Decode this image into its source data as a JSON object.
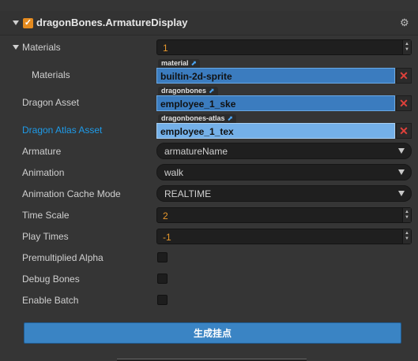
{
  "component": {
    "title": "dragonBones.ArmatureDisplay",
    "enabled": true,
    "gear_icon": "gear-icon"
  },
  "materials": {
    "label": "Materials",
    "count": "1",
    "item_label": "Materials",
    "item_tag": "material",
    "item_value": "builtin-2d-sprite"
  },
  "dragon_asset": {
    "label": "Dragon Asset",
    "tag": "dragonbones",
    "value": "employee_1_ske"
  },
  "dragon_atlas_asset": {
    "label": "Dragon Atlas Asset",
    "tag": "dragonbones-atlas",
    "value": "employee_1_tex"
  },
  "armature": {
    "label": "Armature",
    "value": "armatureName"
  },
  "animation": {
    "label": "Animation",
    "value": "walk"
  },
  "animation_cache_mode": {
    "label": "Animation Cache Mode",
    "value": "REALTIME"
  },
  "time_scale": {
    "label": "Time Scale",
    "value": "2"
  },
  "play_times": {
    "label": "Play Times",
    "value": "-1"
  },
  "premultiplied_alpha": {
    "label": "Premultiplied Alpha",
    "checked": false
  },
  "debug_bones": {
    "label": "Debug Bones",
    "checked": false
  },
  "enable_batch": {
    "label": "Enable Batch",
    "checked": false
  },
  "generate_button": {
    "label": "生成挂点"
  },
  "colors": {
    "accent": "#e58b1f",
    "asset_field": "#3b7cbf",
    "asset_field_highlight": "#74b0e8",
    "link_label": "#1e9be9",
    "button": "#3a84c4"
  }
}
